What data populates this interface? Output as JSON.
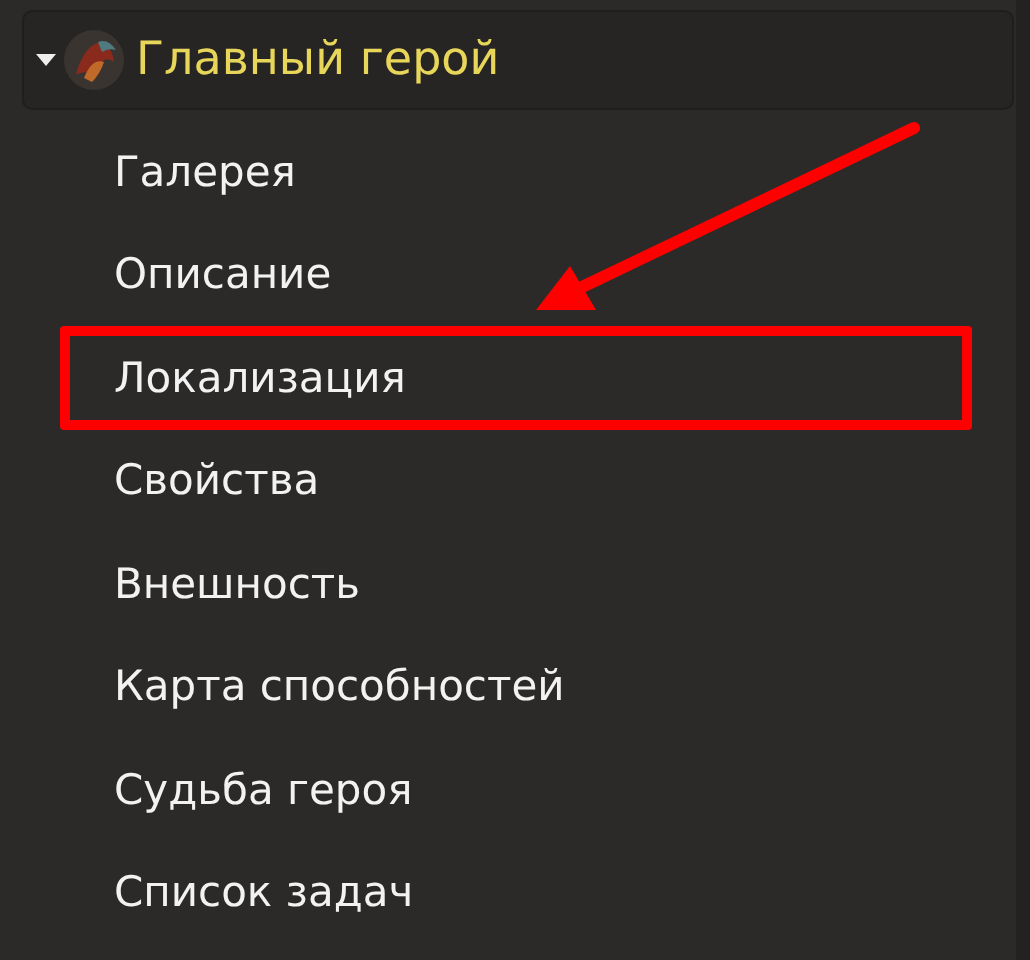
{
  "group": {
    "title": "Главный герой",
    "expanded": true,
    "items": [
      {
        "label": "Галерея",
        "highlighted": false
      },
      {
        "label": "Описание",
        "highlighted": false
      },
      {
        "label": "Локализация",
        "highlighted": true
      },
      {
        "label": "Свойства",
        "highlighted": false
      },
      {
        "label": "Внешность",
        "highlighted": false
      },
      {
        "label": "Карта способностей",
        "highlighted": false
      },
      {
        "label": "Судьба героя",
        "highlighted": false
      },
      {
        "label": "Список задач",
        "highlighted": false
      }
    ]
  }
}
